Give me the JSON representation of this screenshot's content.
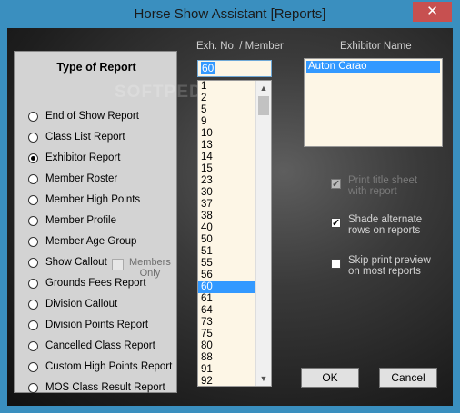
{
  "window": {
    "title": "Horse Show Assistant  [Reports]",
    "close_glyph": "✕"
  },
  "report_group": {
    "title": "Type of Report",
    "items": [
      {
        "label": "End of Show Report",
        "selected": false
      },
      {
        "label": "Class List Report",
        "selected": false
      },
      {
        "label": "Exhibitor Report",
        "selected": true
      },
      {
        "label": "Member Roster",
        "selected": false
      },
      {
        "label": "Member High Points",
        "selected": false
      },
      {
        "label": "Member Profile",
        "selected": false
      },
      {
        "label": "Member Age Group",
        "selected": false
      },
      {
        "label": "Show Callout",
        "selected": false
      },
      {
        "label": "Grounds Fees Report",
        "selected": false
      },
      {
        "label": "Division Callout",
        "selected": false
      },
      {
        "label": "Division Points Report",
        "selected": false
      },
      {
        "label": "Cancelled Class Report",
        "selected": false
      },
      {
        "label": "Custom High Points Report",
        "selected": false
      },
      {
        "label": "MOS Class Result Report",
        "selected": false
      }
    ],
    "members_only": {
      "line1": "Members",
      "line2": "Only",
      "checked": false,
      "enabled": false
    }
  },
  "exhibitor_no": {
    "header": "Exh. No. / Member",
    "value": "60",
    "items": [
      "1",
      "2",
      "5",
      "9",
      "10",
      "13",
      "14",
      "15",
      "23",
      "30",
      "37",
      "38",
      "40",
      "50",
      "51",
      "55",
      "56",
      "60",
      "61",
      "64",
      "73",
      "75",
      "80",
      "88",
      "91",
      "92"
    ],
    "selected": "60"
  },
  "exhibitor_name": {
    "header": "Exhibitor Name",
    "items": [
      "Auton Carao"
    ]
  },
  "options": [
    {
      "line1": "Print title sheet",
      "line2": "with report",
      "checked": true,
      "enabled": false
    },
    {
      "line1": "Shade alternate",
      "line2": "rows on reports",
      "checked": true,
      "enabled": true
    },
    {
      "line1": "Skip print preview",
      "line2": "on most reports",
      "checked": false,
      "enabled": true
    }
  ],
  "buttons": {
    "ok": "OK",
    "cancel": "Cancel"
  },
  "watermark": "SOFTPEDIA",
  "colors": {
    "accent": "#3399ff",
    "titlebar": "#3a8fbf",
    "close": "#c75050"
  }
}
